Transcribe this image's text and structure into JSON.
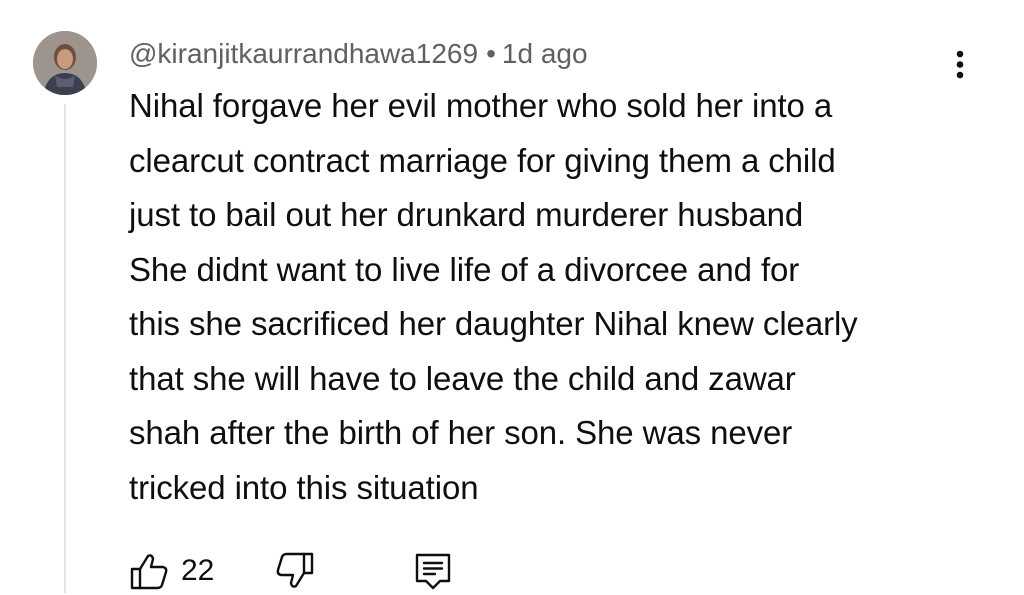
{
  "comment": {
    "author": "@kiranjitkaurrandhawa1269",
    "separator": "•",
    "timestamp": "1d ago",
    "text": "Nihal forgave her evil mother who sold her into a\nclearcut contract marriage for giving them a child\njust to bail out her drunkard murderer husband\nShe didnt want to live life of a divorcee and for\nthis she sacrificed her daughter Nihal knew clearly\nthat she will have to leave the child and zawar\nshah after the birth of her son. She was never\ntricked into this situation"
  },
  "actions": {
    "like_count": "22",
    "icons": [
      "thumbs-up-icon",
      "thumbs-down-icon",
      "reply-icon",
      "more-vert-icon"
    ]
  },
  "colors": {
    "text": "#0f0f0f",
    "meta": "#606060",
    "thread_line": "#e3e3e3",
    "background": "#ffffff"
  }
}
